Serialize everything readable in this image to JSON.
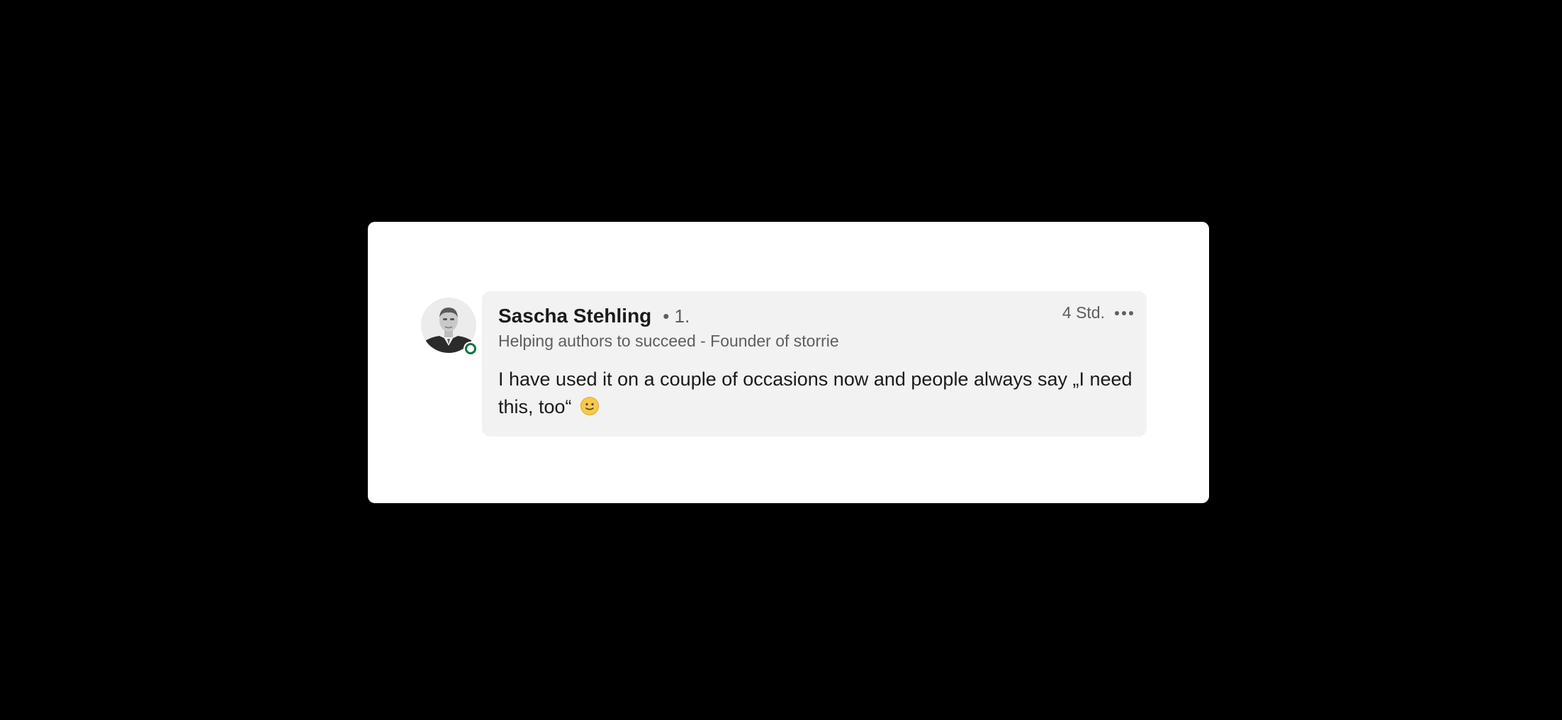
{
  "comment": {
    "author": {
      "name": "Sascha Stehling",
      "degree": "• 1.",
      "headline": "Helping authors to succeed - Founder of storrie",
      "avatar_icon": "profile-photo",
      "status": "online",
      "status_color": "#057642"
    },
    "timestamp": "4 Std.",
    "more_icon": "more-options-icon",
    "text": "I have used it on a couple of occasions now and people always say „I need this, too“",
    "emoji": "slightly-smiling-face-icon"
  }
}
